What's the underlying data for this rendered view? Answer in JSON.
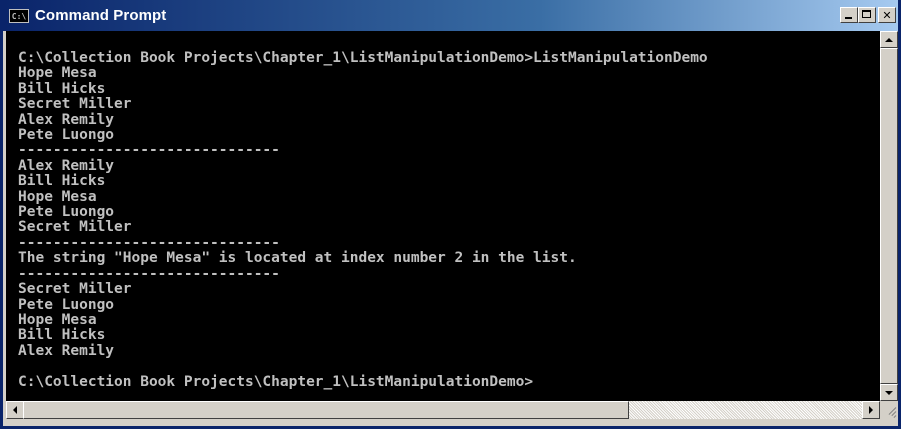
{
  "window": {
    "title": "Command Prompt",
    "icon": "cmd-icon",
    "icon_glyph": "C:\\",
    "buttons": [
      "minimize-icon",
      "maximize-icon",
      "close-icon"
    ],
    "close_glyph": "✕"
  },
  "console": {
    "background": "#000000",
    "foreground": "#c0c0c0",
    "lines": [
      "C:\\Collection Book Projects\\Chapter_1\\ListManipulationDemo>ListManipulationDemo",
      "Hope Mesa",
      "Bill Hicks",
      "Secret Miller",
      "Alex Remily",
      "Pete Luongo",
      "------------------------------",
      "Alex Remily",
      "Bill Hicks",
      "Hope Mesa",
      "Pete Luongo",
      "Secret Miller",
      "------------------------------",
      "The string \"Hope Mesa\" is located at index number 2 in the list.",
      "------------------------------",
      "Secret Miller",
      "Pete Luongo",
      "Hope Mesa",
      "Bill Hicks",
      "Alex Remily",
      "",
      "C:\\Collection Book Projects\\Chapter_1\\ListManipulationDemo>"
    ]
  },
  "colors": {
    "titlebar_start": "#0a246a",
    "titlebar_end": "#a6caf0",
    "chrome": "#d4d0c8"
  }
}
